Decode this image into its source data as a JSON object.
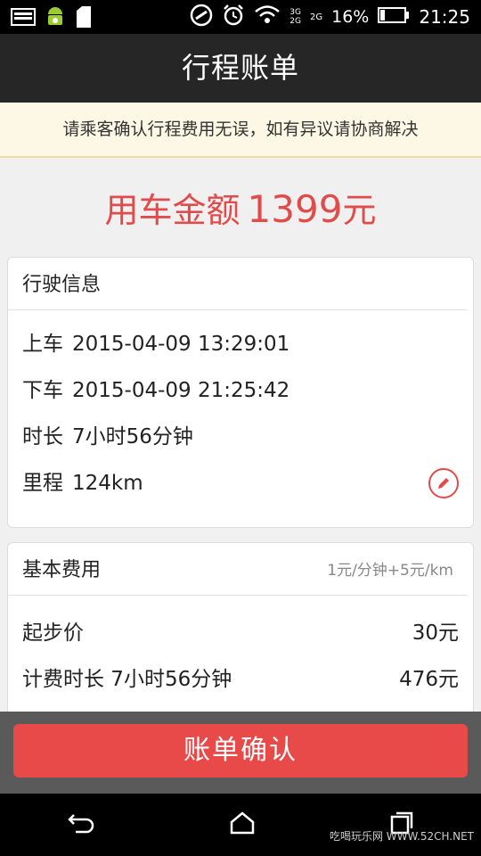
{
  "status_bar": {
    "signal_labels": [
      "3G",
      "2G",
      "2G"
    ],
    "battery_percent": "16%",
    "time": "21:25",
    "icons": [
      "gallery-icon",
      "android-icon",
      "sdcard-icon",
      "nfc-icon",
      "alarm-icon",
      "wifi-icon",
      "signal-icon",
      "battery-icon"
    ]
  },
  "header": {
    "title": "行程账单"
  },
  "notice": {
    "text": "请乘客确认行程费用无误，如有异议请协商解决"
  },
  "amount": {
    "label": "用车金额",
    "value": "1399",
    "unit": "元"
  },
  "trip_info": {
    "title": "行驶信息",
    "rows": [
      {
        "label": "上车",
        "value": "2015-04-09 13:29:01"
      },
      {
        "label": "下车",
        "value": "2015-04-09 21:25:42"
      },
      {
        "label": "时长",
        "value": "7小时56分钟"
      },
      {
        "label": "里程",
        "value": "124km"
      }
    ]
  },
  "base_fee": {
    "title": "基本费用",
    "rate": "1元/分钟+5元/km",
    "rows": [
      {
        "label": "起步价",
        "value": "30元"
      },
      {
        "label": "计费时长 7小时56分钟",
        "value": "476元"
      }
    ]
  },
  "confirm_button": {
    "label": "账单确认"
  },
  "nav_bar": {
    "icons": [
      "back-icon",
      "home-icon",
      "recents-icon"
    ]
  },
  "watermark": {
    "text": "吃喝玩乐网 WWW.52CH.NET"
  },
  "colors": {
    "accent": "#e84a4a",
    "header": "#262626",
    "notice_bg": "#fdf8e6"
  }
}
